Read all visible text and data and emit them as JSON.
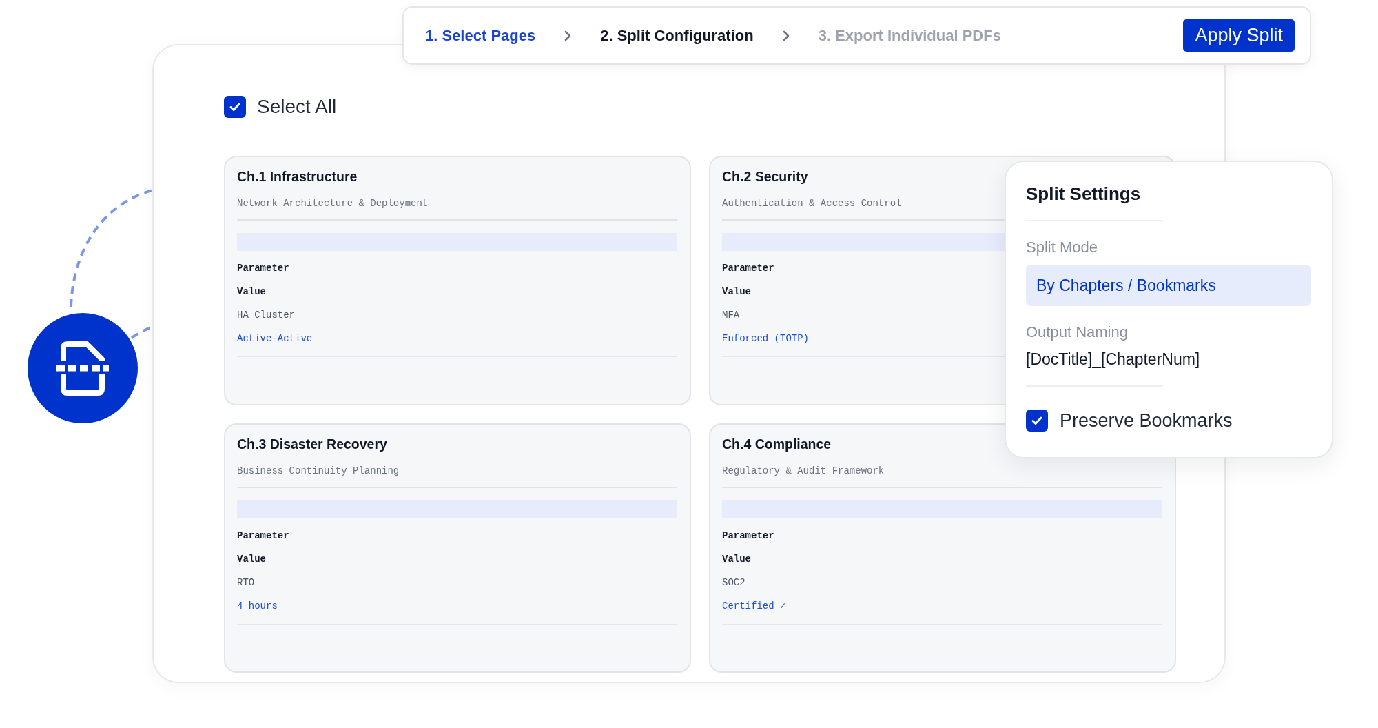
{
  "stepper": {
    "steps": [
      {
        "label": "1. Select Pages",
        "completed": true,
        "selected": false
      },
      {
        "label": "2. Split Configuration",
        "completed": false,
        "selected": true
      },
      {
        "label": "3. Export Individual PDFs",
        "completed": false,
        "selected": false
      }
    ],
    "apply_button": {
      "label": "Apply Split"
    }
  },
  "select_all": {
    "label": "Select All",
    "checked": true
  },
  "chapters": [
    {
      "title": "Ch.1 Infrastructure",
      "subtitle": "Network Architecture & Deployment",
      "table": {
        "columns": [
          "Parameter",
          "Value"
        ],
        "rows": [
          [
            "HA Cluster",
            "Active-Active"
          ]
        ]
      }
    },
    {
      "title": "Ch.2 Security",
      "subtitle": "Authentication & Access Control",
      "table": {
        "columns": [
          "Parameter",
          "Value"
        ],
        "rows": [
          [
            "MFA",
            "Enforced (TOTP)"
          ]
        ]
      }
    },
    {
      "title": "Ch.3 Disaster Recovery",
      "subtitle": "Business Continuity Planning",
      "table": {
        "columns": [
          "Parameter",
          "Value"
        ],
        "rows": [
          [
            "RTO",
            "4 hours"
          ]
        ]
      }
    },
    {
      "title": "Ch.4 Compliance",
      "subtitle": "Regulatory & Audit Framework",
      "table": {
        "columns": [
          "Parameter",
          "Value"
        ],
        "rows": [
          [
            "SOC2",
            "Certified ✓"
          ]
        ]
      }
    }
  ],
  "split_settings": {
    "title": "Split Settings",
    "fields": [
      {
        "kind": "select",
        "label": "Split Mode",
        "value": "By Chapters / Bookmarks"
      },
      {
        "kind": "text",
        "label": "Output Naming",
        "value": "[DocTitle]_[ChapterNum]"
      }
    ],
    "preserve_bookmarks": {
      "label": "Preserve Bookmarks",
      "checked": true
    }
  }
}
